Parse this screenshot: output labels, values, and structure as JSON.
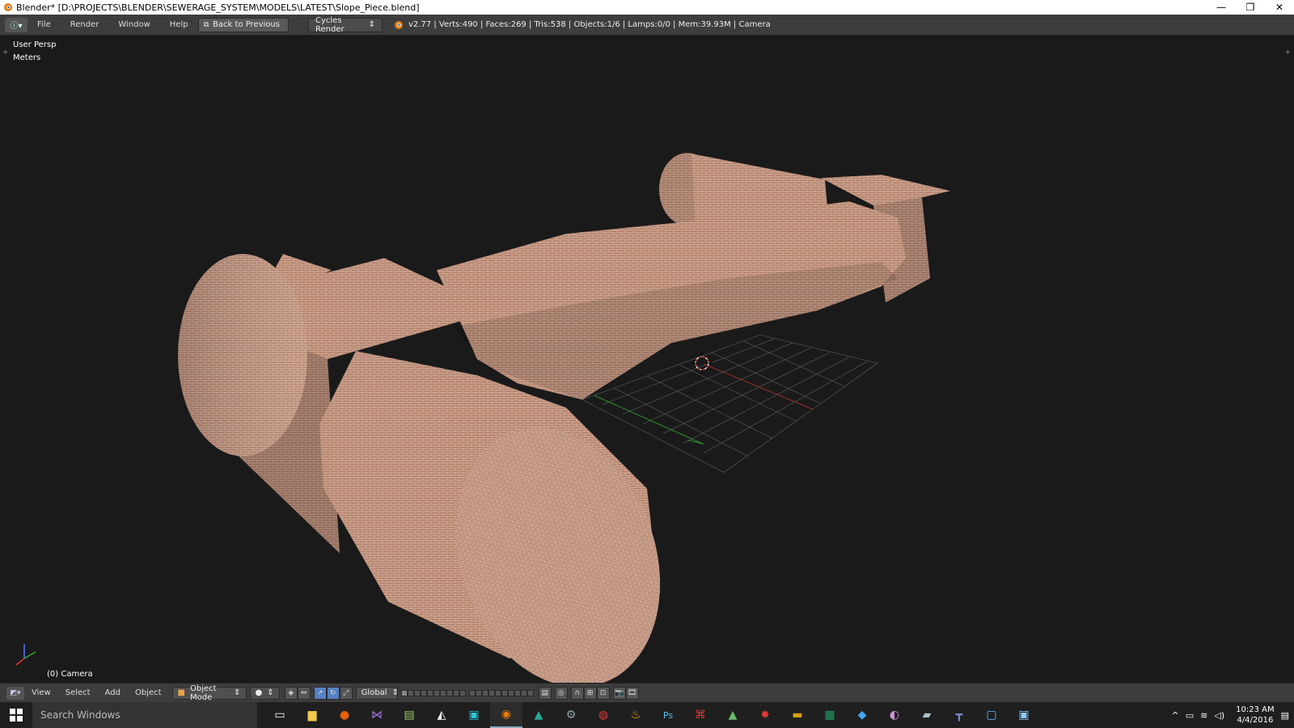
{
  "window": {
    "title": "Blender* [D:\\PROJECTS\\BLENDER\\SEWERAGE_SYSTEM\\MODELS\\LATEST\\Slope_Piece.blend]",
    "minimize": "—",
    "maximize": "❐",
    "close": "✕"
  },
  "info_header": {
    "menus": [
      "File",
      "Render",
      "Window",
      "Help"
    ],
    "back_button": "Back to Previous",
    "render_engine": "Cycles Render",
    "stats": "v2.77 | Verts:490 | Faces:269 | Tris:538 | Objects:1/6 | Lamps:0/0 | Mem:39.93M | Camera"
  },
  "viewport": {
    "view_name": "User Persp",
    "units": "Meters",
    "active_object": "(0) Camera"
  },
  "view3d_header": {
    "menus": [
      "View",
      "Select",
      "Add",
      "Object"
    ],
    "mode": "Object Mode",
    "orientation": "Global"
  },
  "taskbar": {
    "search_placeholder": "Search Windows",
    "time": "10:23 AM",
    "date": "4/4/2016",
    "apps": [
      "task-view",
      "file-explorer",
      "firefox",
      "visual-studio",
      "notepad",
      "unity",
      "app-green",
      "blender",
      "maya",
      "steam",
      "creative-cloud",
      "app-flame",
      "photoshop",
      "acrobat",
      "app-triangle",
      "app-red",
      "app-folder",
      "excel",
      "app-box",
      "app-paint",
      "app-laptop",
      "app-t",
      "app-remote",
      "app-screen"
    ],
    "accent": "#5680c2"
  },
  "colors": {
    "viewport_bg": "#1a1a1a",
    "brick": "#b98770",
    "grid": "#5a5a5a",
    "axis_x": "#b33",
    "axis_y": "#3a3"
  }
}
